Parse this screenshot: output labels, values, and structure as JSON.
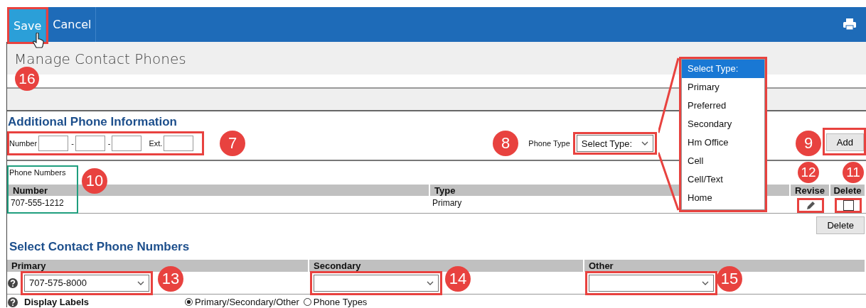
{
  "toolbar": {
    "buttons": [
      {
        "label": "Save",
        "selected": true
      },
      {
        "label": "Cancel",
        "selected": false
      }
    ]
  },
  "page_title": "Manage Contact Phones",
  "additional": {
    "heading": "Additional Phone Information",
    "number_label": "Number",
    "separators": [
      "-",
      "-"
    ],
    "ext_label": "Ext.",
    "phone_type_label": "Phone Type",
    "phone_type_value": "Select Type:",
    "add_button": "Add"
  },
  "type_dropdown": {
    "options": [
      {
        "label": "Select Type:",
        "selected": true
      },
      {
        "label": "Primary",
        "selected": false
      },
      {
        "label": "Preferred",
        "selected": false
      },
      {
        "label": "Secondary",
        "selected": false
      },
      {
        "label": "Hm Office",
        "selected": false
      },
      {
        "label": "Cell",
        "selected": false
      },
      {
        "label": "Cell/Text",
        "selected": false
      },
      {
        "label": "Home",
        "selected": false
      }
    ]
  },
  "phone_numbers": {
    "caption": "Phone Numbers",
    "columns": [
      "Number",
      "Type",
      "Revise",
      "Delete"
    ],
    "rows": [
      {
        "number": "707-555-1212",
        "type": "Primary",
        "checked": false
      }
    ],
    "delete_button": "Delete"
  },
  "select_contact": {
    "heading": "Select Contact Phone Numbers",
    "columns": [
      {
        "label": "Primary",
        "value": "707-575-8000"
      },
      {
        "label": "Secondary"
      },
      {
        "label": "Other"
      }
    ],
    "display_labels": "Display Labels",
    "options": [
      {
        "label": "Primary/Secondary/Other",
        "selected": true
      },
      {
        "label": "Phone Types",
        "selected": false
      }
    ]
  },
  "callouts": [
    {
      "number": "16"
    },
    {
      "number": "7"
    },
    {
      "number": "8"
    },
    {
      "number": "9"
    },
    {
      "number": "10"
    },
    {
      "number": "12"
    },
    {
      "number": "11"
    },
    {
      "number": "13"
    },
    {
      "number": "14"
    },
    {
      "number": "15"
    }
  ]
}
